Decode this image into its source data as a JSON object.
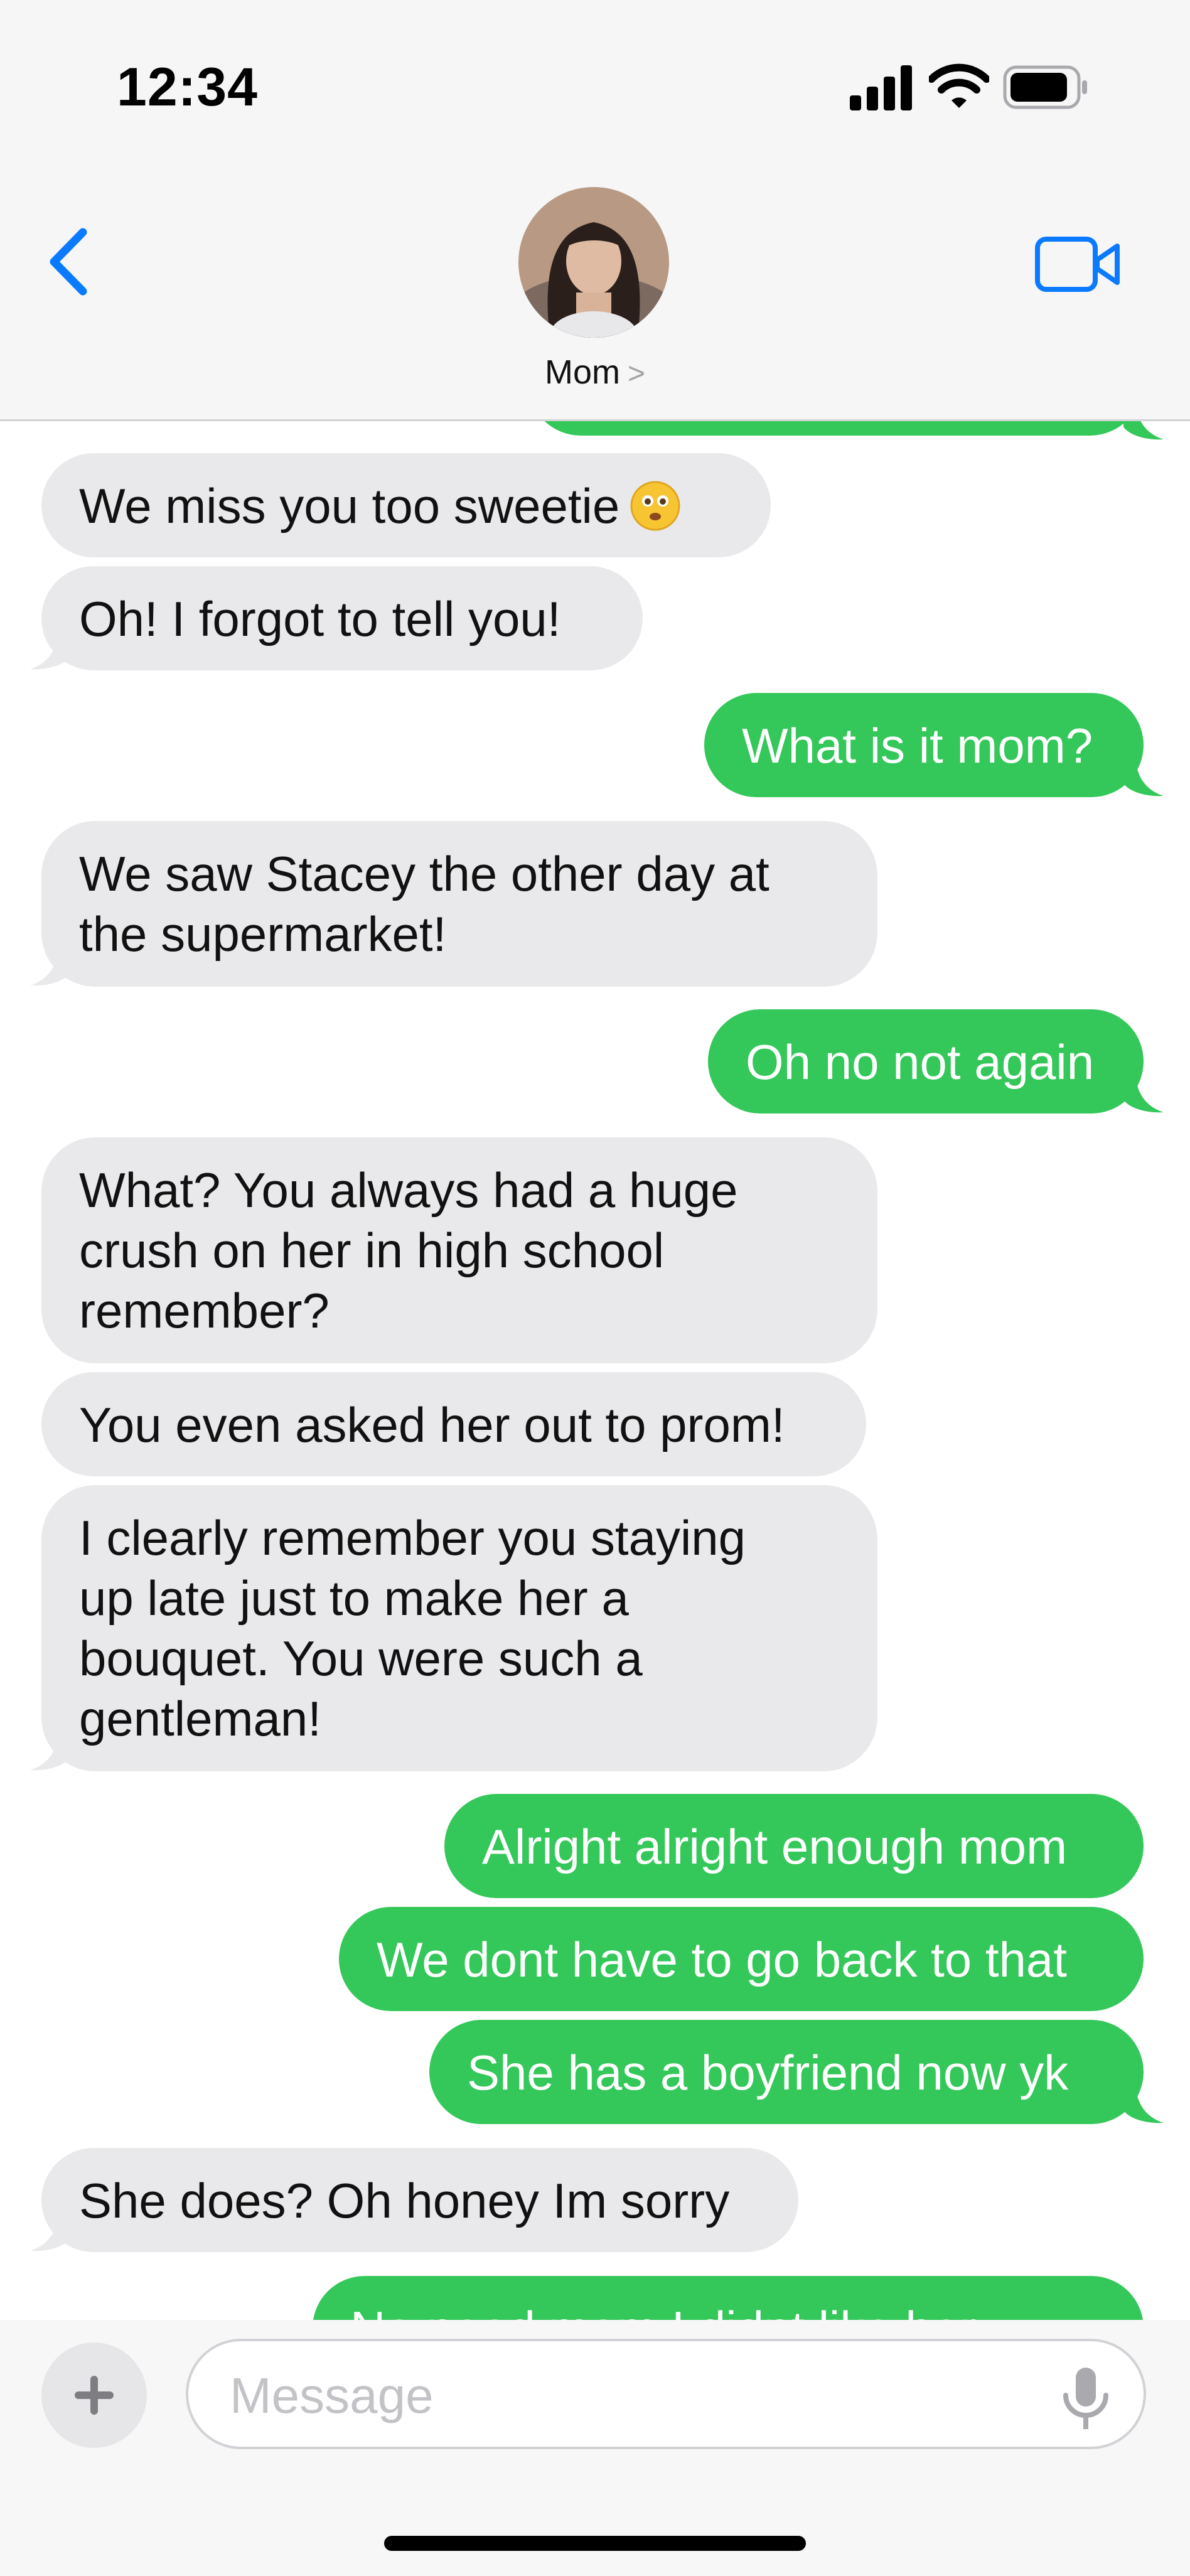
{
  "status_bar": {
    "time": "12:34"
  },
  "header": {
    "contact_name": "Mom",
    "contact_chevron": ">"
  },
  "messages": [
    {
      "id": "partial-top",
      "direction": "outgoing",
      "text": ""
    },
    {
      "id": "m1",
      "direction": "incoming",
      "text": "We miss you too sweetie"
    },
    {
      "id": "m2",
      "direction": "incoming",
      "text": "Oh! I forgot to tell you!"
    },
    {
      "id": "m3",
      "direction": "outgoing",
      "text": "What is it mom?"
    },
    {
      "id": "m4",
      "direction": "incoming",
      "text": "We saw Stacey the other day at\nthe supermarket!"
    },
    {
      "id": "m5",
      "direction": "outgoing",
      "text": "Oh no not again"
    },
    {
      "id": "m6",
      "direction": "incoming",
      "text": "What? You always had a huge\ncrush on her in high school\nremember?"
    },
    {
      "id": "m7",
      "direction": "incoming",
      "text": "You even asked her out to prom!"
    },
    {
      "id": "m8",
      "direction": "incoming",
      "text": "I clearly remember you staying\nup late just to make her a\nbouquet. You were such a\ngentleman!"
    },
    {
      "id": "m9",
      "direction": "outgoing",
      "text": "Alright alright enough mom"
    },
    {
      "id": "m10",
      "direction": "outgoing",
      "text": "We dont have to go back to that"
    },
    {
      "id": "m11",
      "direction": "outgoing",
      "text": "She has a boyfriend now yk"
    },
    {
      "id": "m12",
      "direction": "incoming",
      "text": "She does? Oh honey Im sorry"
    },
    {
      "id": "m13",
      "direction": "outgoing",
      "text": "No need mom I didnt like her"
    }
  ],
  "composer": {
    "placeholder": "Message",
    "value": ""
  },
  "colors": {
    "outgoing": "#34c759",
    "incoming": "#e9e9eb",
    "accent": "#0a7aff"
  },
  "icons": [
    "back-chevron-icon",
    "video-call-icon",
    "plus-icon",
    "microphone-icon",
    "cellular-signal-icon",
    "wifi-icon",
    "battery-icon",
    "slightly-smiling-face-emoji"
  ]
}
